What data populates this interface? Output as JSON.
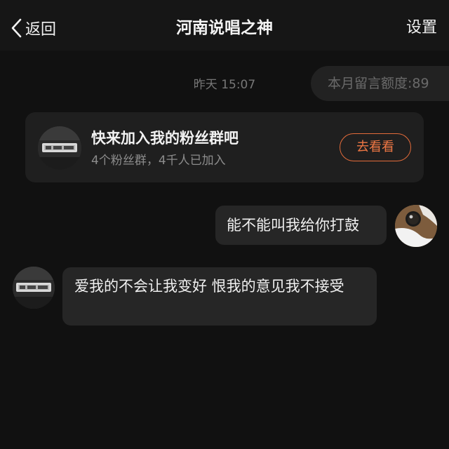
{
  "header": {
    "back_label": "返回",
    "title": "河南说唱之神",
    "settings_label": "设置"
  },
  "thread": {
    "timestamp": "昨天 15:07",
    "quota_text": "本月留言额度:89"
  },
  "group_card": {
    "title": "快来加入我的粉丝群吧",
    "subtitle": "4个粉丝群，4千人已加入",
    "button_label": "去看看"
  },
  "messages": [
    {
      "sender": "self",
      "text": "能不能叫我给你打鼓"
    },
    {
      "sender": "other",
      "text": "爱我的不会让我变好 恨我的意见我不接受"
    }
  ],
  "colors": {
    "background": "#111111",
    "header": "#161616",
    "bubble": "#262626",
    "card": "#1f1f1f",
    "accent": "#ee7744"
  }
}
